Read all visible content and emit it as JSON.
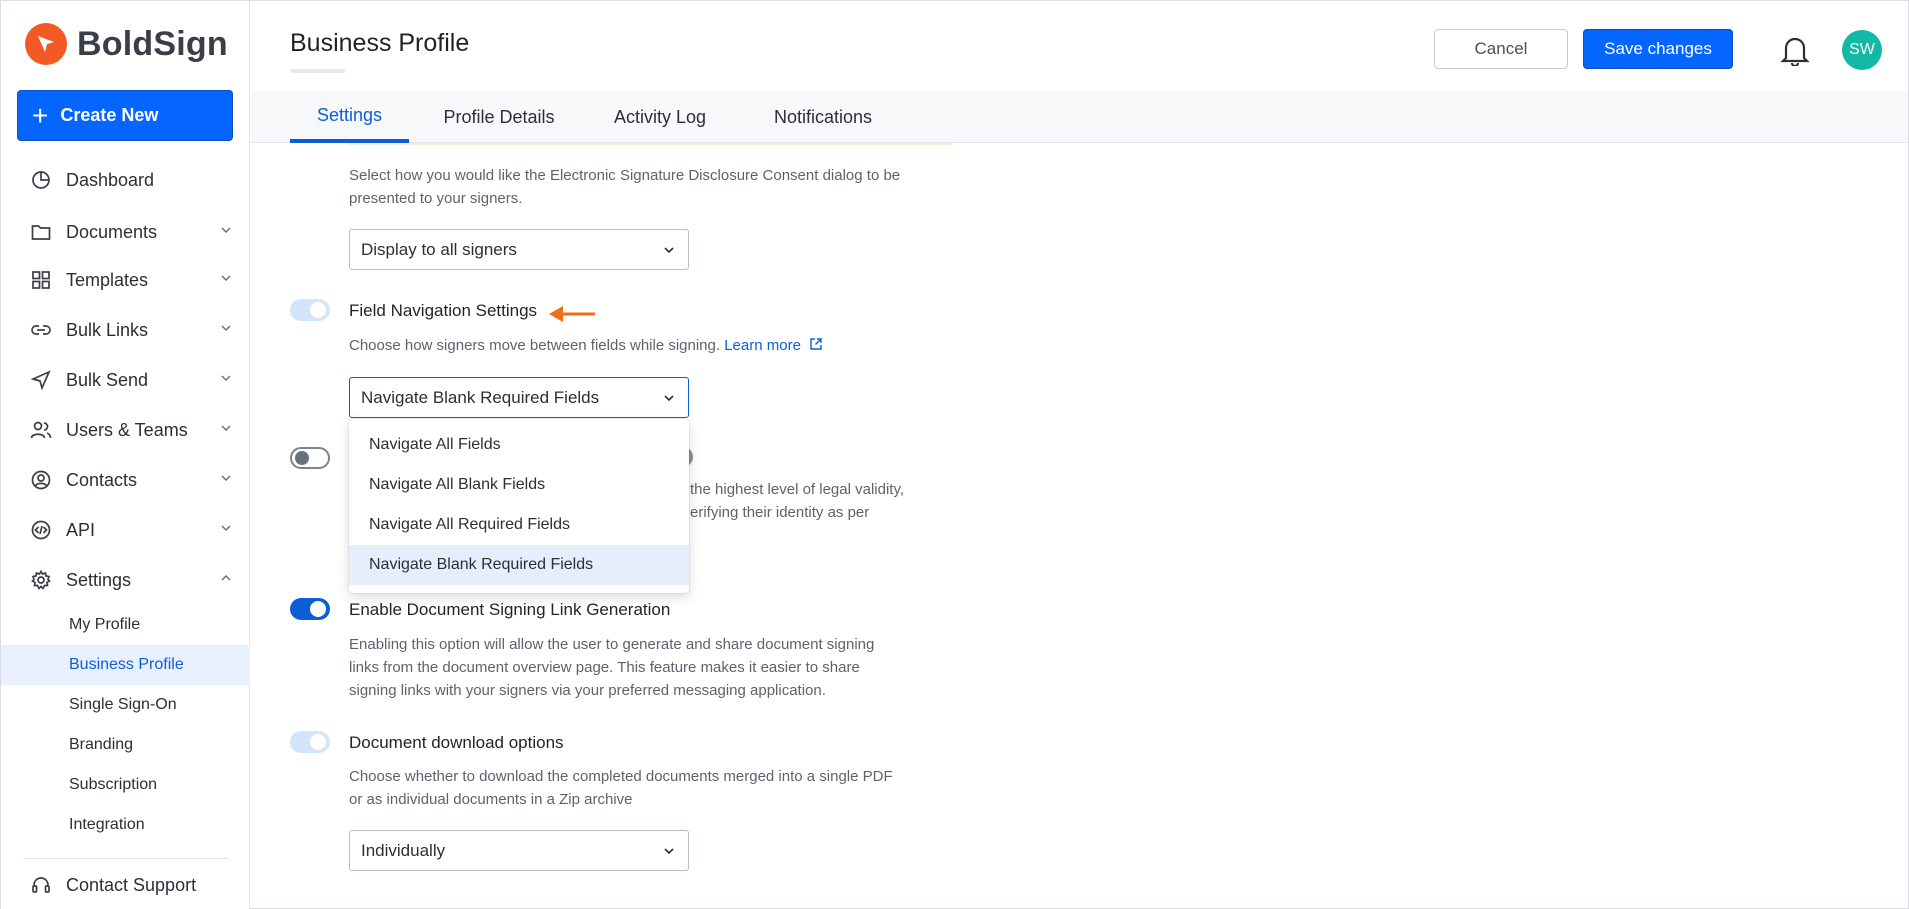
{
  "brand": {
    "name": "BoldSign",
    "accent": "#f15a24",
    "primary": "#0565ff"
  },
  "sidebar": {
    "create_label": "Create New",
    "items": [
      {
        "label": "Dashboard",
        "icon": "pie-chart-icon"
      },
      {
        "label": "Documents",
        "icon": "folder-icon"
      },
      {
        "label": "Templates",
        "icon": "grid-icon"
      },
      {
        "label": "Bulk Links",
        "icon": "link-icon"
      },
      {
        "label": "Bulk Send",
        "icon": "send-icon"
      },
      {
        "label": "Users & Teams",
        "icon": "users-icon"
      },
      {
        "label": "Contacts",
        "icon": "contact-icon"
      },
      {
        "label": "API",
        "icon": "code-icon"
      },
      {
        "label": "Settings",
        "icon": "gear-icon"
      }
    ],
    "settings_sub": [
      "My Profile",
      "Business Profile",
      "Single Sign-On",
      "Branding",
      "Subscription",
      "Integration"
    ],
    "support_label": "Contact Support"
  },
  "header": {
    "title": "Business Profile",
    "cancel_label": "Cancel",
    "save_label": "Save changes",
    "avatar_initials": "SW"
  },
  "tabs": [
    "Settings",
    "Profile Details",
    "Activity Log",
    "Notifications"
  ],
  "consent": {
    "description_line1": "Select how you would like the Electronic Signature Disclosure Consent dialog to be",
    "description_line2": "presented to your signers.",
    "value": "Display to all signers"
  },
  "field_navigation": {
    "title": "Field Navigation Settings",
    "description": "Choose how signers move between fields while signing.",
    "learn_more": "Learn more",
    "value": "Navigate Blank Required Fields",
    "options": [
      "Navigate All Fields",
      "Navigate All Blank Fields",
      "Navigate All Required Fields",
      "Navigate Blank Required Fields"
    ]
  },
  "obscured": {
    "line1": "the highest level of legal validity,",
    "line2": "erifying their identity as per"
  },
  "signing_link": {
    "title": "Enable Document Signing Link Generation",
    "line1": "Enabling this option will allow the user to generate and share document signing",
    "line2": "links from the document overview page. This feature makes it easier to share",
    "line3": "signing links with your signers via your preferred messaging application."
  },
  "download": {
    "title": "Document download options",
    "line1": "Choose whether to download the completed documents merged into a single PDF",
    "line2": "or as individual documents in a Zip archive",
    "value": "Individually"
  }
}
